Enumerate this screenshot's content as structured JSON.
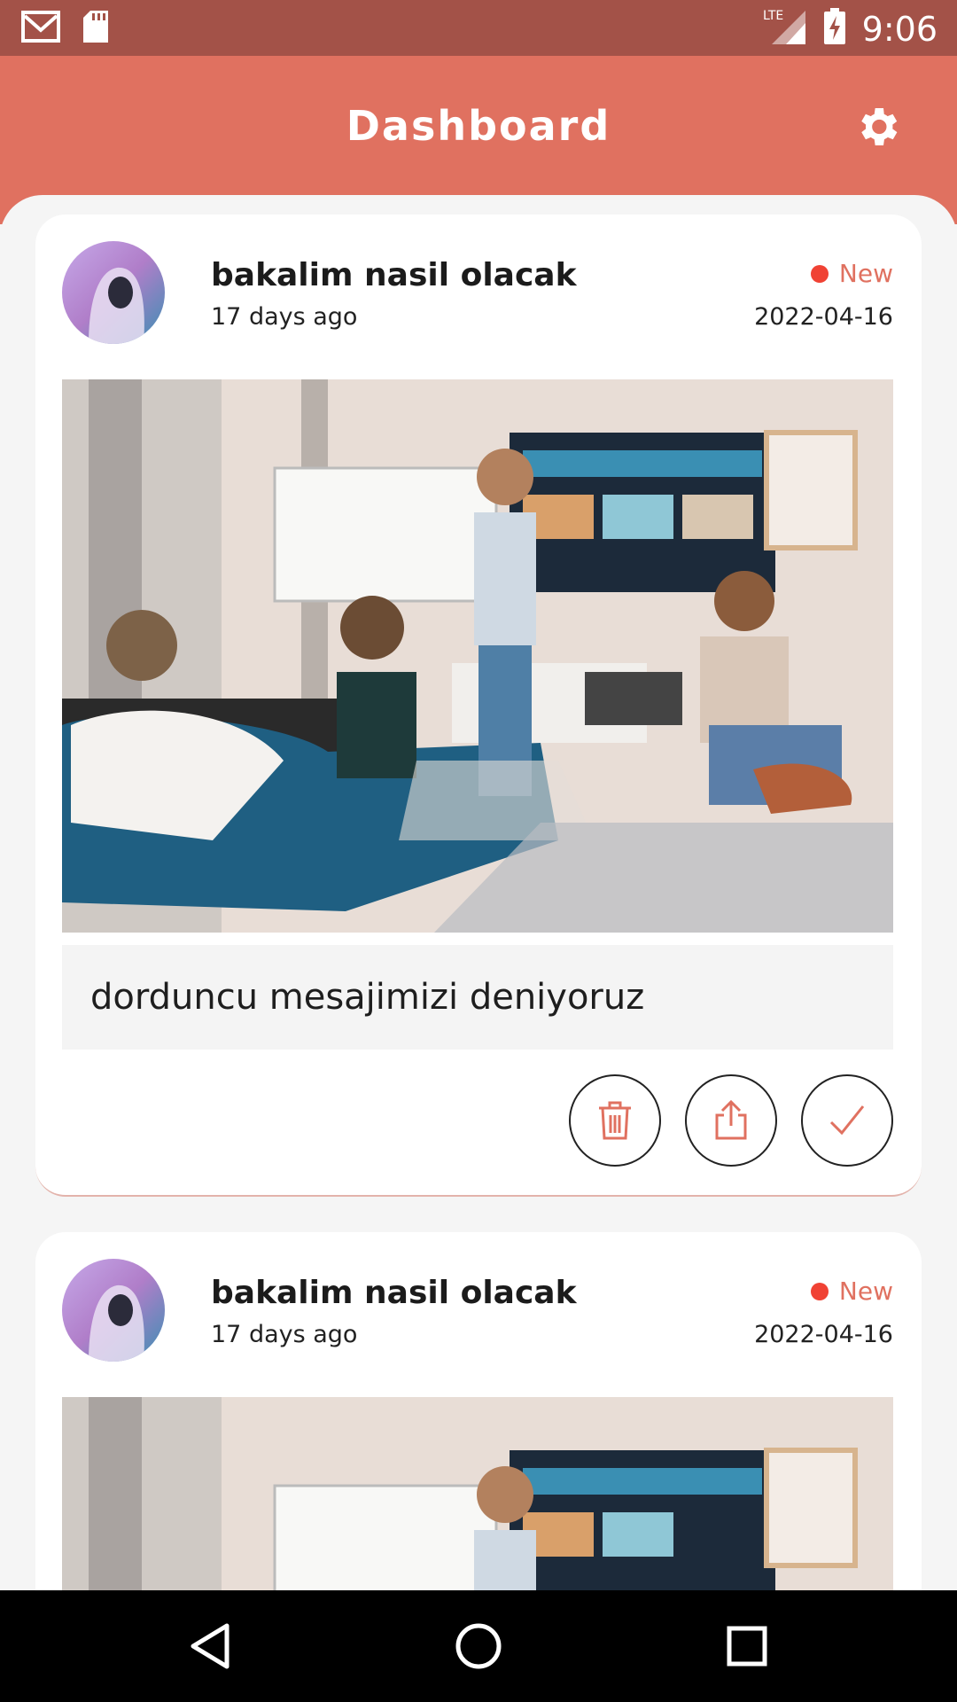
{
  "status_bar": {
    "time": "9:06",
    "network": "LTE",
    "icons": [
      "gmail-icon",
      "sd-card-icon",
      "signal-icon",
      "battery-charging-icon"
    ]
  },
  "header": {
    "title": "Dashboard",
    "settings_icon": "gear-icon"
  },
  "posts": [
    {
      "author": "bakalim nasil olacak",
      "posted_ago": "17 days  ago",
      "status": "New",
      "date": "2022-04-16",
      "message": "dorduncu mesajimizi deniyoruz",
      "image": "office-meeting-photo",
      "actions": [
        "trash-icon",
        "share-icon",
        "check-icon"
      ]
    },
    {
      "author": "bakalim nasil olacak",
      "posted_ago": "17 days  ago",
      "status": "New",
      "date": "2022-04-16",
      "image": "office-meeting-photo"
    }
  ],
  "colors": {
    "status_bar": "#a35248",
    "header": "#e07160",
    "accent": "#e07160",
    "new_dot": "#f04234"
  },
  "nav_bar": {
    "icons": [
      "back-icon",
      "home-icon",
      "recents-icon"
    ]
  }
}
